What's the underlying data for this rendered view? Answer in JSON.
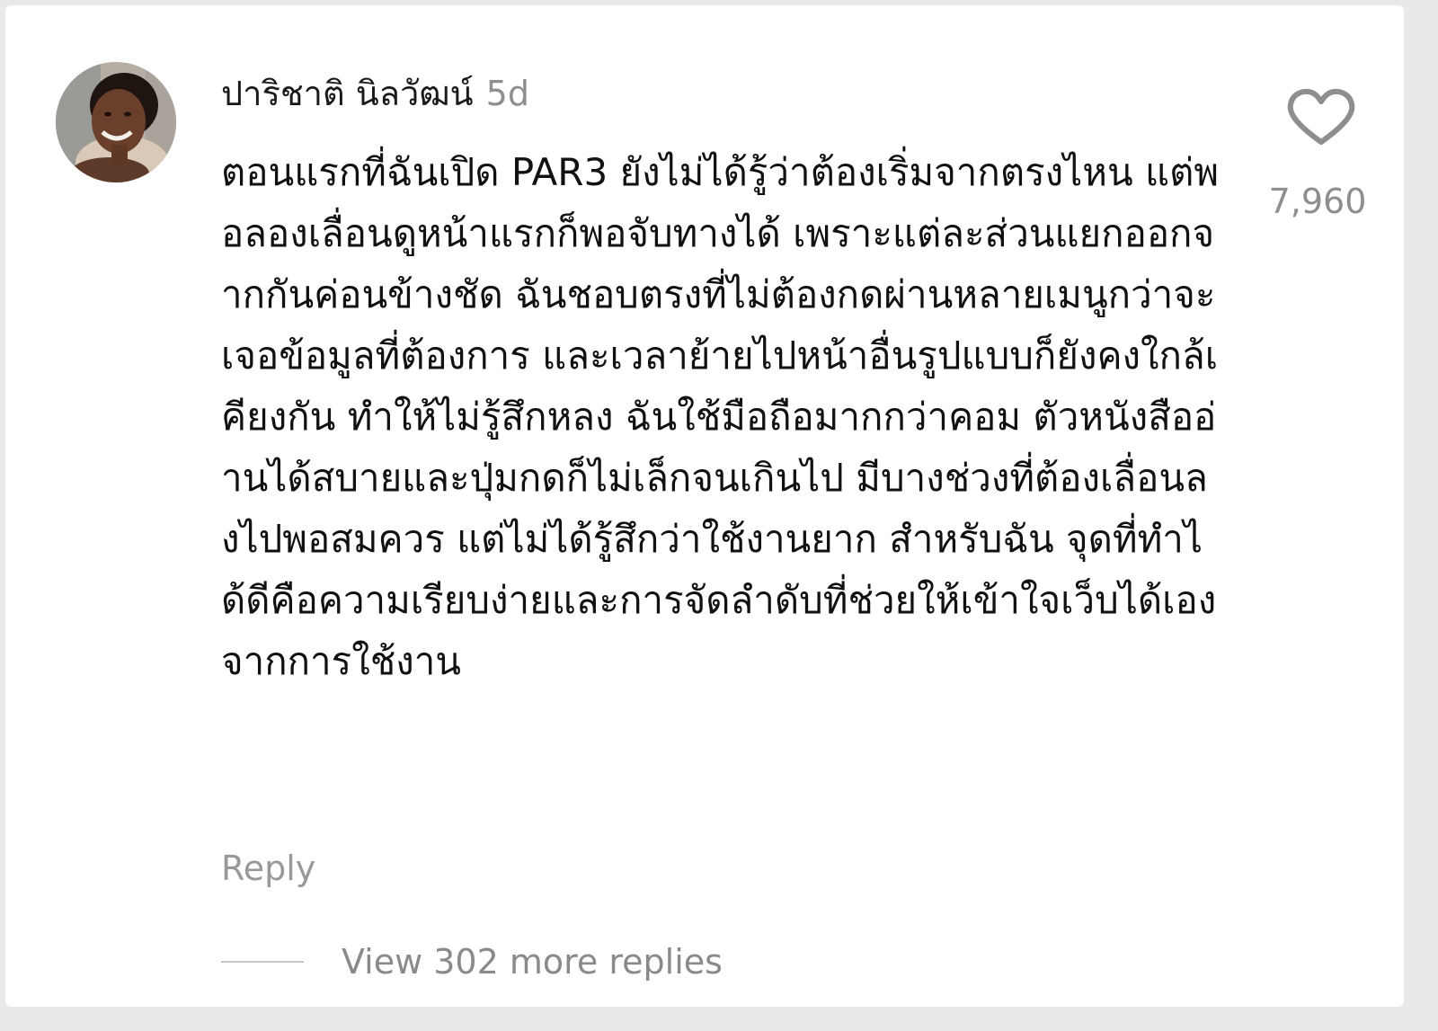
{
  "comment": {
    "username": "ปาริชาติ นิลวัฒน์",
    "timestamp": "5d",
    "text": "ตอนแรกที่ฉันเปิด PAR3 ยังไม่ได้รู้ว่าต้องเริ่มจากตรงไหน แต่พอลองเลื่อนดูหน้าแรกก็พอจับทางได้ เพราะแต่ละส่วนแยกออกจากกันค่อนข้างชัด ฉันชอบตรงที่ไม่ต้องกดผ่านหลายเมนูกว่าจะเจอข้อมูลที่ต้องการ และเวลาย้ายไปหน้าอื่นรูปแบบก็ยังคงใกล้เคียงกัน ทำให้ไม่รู้สึกหลง ฉันใช้มือถือมากกว่าคอม ตัวหนังสืออ่านได้สบายและปุ่มกดก็ไม่เล็กจนเกินไป มีบางช่วงที่ต้องเลื่อนลงไปพอสมควร แต่ไม่ได้รู้สึกว่าใช้งานยาก สำหรับฉัน จุดที่ทำได้ดีคือความเรียบง่ายและการจัดลำดับที่ช่วยให้เข้าใจเว็บได้เองจากการใช้งาน",
    "like_icon": "heart-outline-icon",
    "like_count": "7,960",
    "reply_label": "Reply",
    "view_replies_label": "View 302 more replies"
  },
  "colors": {
    "primary_text": "#111111",
    "secondary_text": "#8e8e8e",
    "background": "#ffffff"
  }
}
